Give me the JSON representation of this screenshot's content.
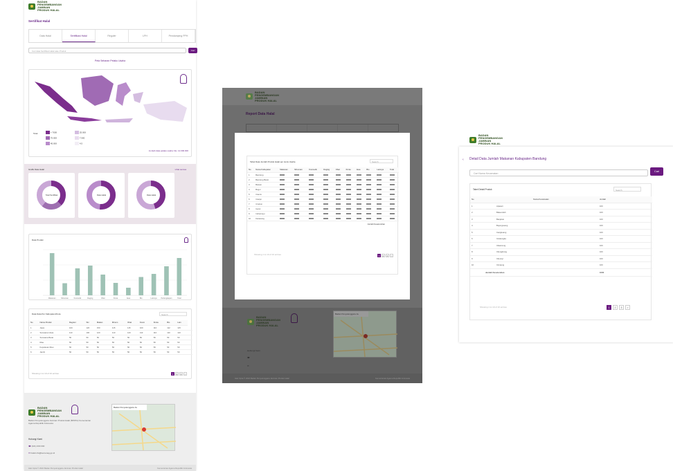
{
  "brand": {
    "name": "BADAN PENGEMBANGAN JAMINAN PRODUK HALAL",
    "logo_color": "#3f7d2a"
  },
  "accent": "#6b1a80",
  "panel1": {
    "title": "Sertifikat Halal",
    "tabs": [
      "Data Halal",
      "Sertifikasi Halal",
      "Reguler",
      "LPH",
      "Pendamping PPH"
    ],
    "search_placeholder": "Cari data Sertifikat Halal atau Produk",
    "search_button": "Cari",
    "map_title": "Peta Sebaran Pelaku Usaha",
    "legend_title": "Total",
    "legend_items": [
      "> 7000",
      "75.000",
      "45.000",
      "25.000",
      "7.500",
      "4.5"
    ],
    "map_note": "Jumlah data pelaku usaha: Rp. 12.000.000",
    "donut_section": {
      "title": "Grafik Data Halal",
      "link": "Lihat semua"
    },
    "donut_labels": [
      "Total Sertifikat",
      "Data Halal",
      "Data Halal"
    ],
    "bar_chart_title": "Data Produk",
    "table": {
      "title": "Data Data Per Kabupaten/Kota",
      "search": "Search",
      "headers": [
        "No",
        "Nama Produk",
        "Reguler",
        "SH",
        "Makan",
        "Minum",
        "Obat",
        "Kosm",
        "Kimia",
        "Bio",
        "Lain",
        "Jumlah"
      ],
      "rows": [
        [
          "1",
          "Jawa",
          "100",
          "120",
          "150",
          "115",
          "115",
          "100",
          "110",
          "112",
          "115"
        ],
        [
          "2",
          "Sumatera Utara",
          "110",
          "100",
          "120",
          "110",
          "120",
          "110",
          "110",
          "110",
          "110"
        ],
        [
          "3",
          "Sumatera Barat",
          "50",
          "50",
          "50",
          "50",
          "50",
          "50",
          "50",
          "50",
          "50"
        ],
        [
          "4",
          "Riau",
          "50",
          "50",
          "50",
          "50",
          "50",
          "50",
          "50",
          "50",
          "50"
        ],
        [
          "5",
          "Kepulauan Riau",
          "50",
          "50",
          "50",
          "50",
          "50",
          "50",
          "50",
          "50",
          "50"
        ],
        [
          "6",
          "Jambi",
          "50",
          "50",
          "50",
          "50",
          "50",
          "50",
          "50",
          "50",
          "50"
        ]
      ],
      "footer": "Showing 1 to 10 of 10 entries"
    },
    "footer": {
      "desc": "Badan Penyelenggara Jaminan Produk Halal (BPJPH) Kementerian Agama Republik Indonesia",
      "contact_title": "Hubungi Kami",
      "phone": "(021) 000 000",
      "email": "halal.info@kemenag.go.id",
      "map_title": "Badan Penyelenggara Ja",
      "copyright": "Hak Cipta © 2022 Badan Penyelenggara Jaminan Produk Halal",
      "right": "Kementerian Agama Republik Indonesia"
    }
  },
  "panel2": {
    "title": "Report Data Halal",
    "modal_title": "Tabel Data Jumlah Produk Halal per Jenis Usaha",
    "search": "Search",
    "headers": [
      "No",
      "Nama Kabupaten",
      "Makanan",
      "Minuman",
      "Kosmetik",
      "Daging",
      "Obat",
      "Kimia",
      "Jasa",
      "Bio",
      "Lainnya",
      "Total",
      "Jumlah"
    ],
    "rows": [
      [
        "1",
        "Bandung"
      ],
      [
        "2",
        "Bandung Barat"
      ],
      [
        "3",
        "Bekasi"
      ],
      [
        "4",
        "Bogor"
      ],
      [
        "5",
        "Ciamis"
      ],
      [
        "6",
        "Cianjur"
      ],
      [
        "7",
        "Cirebon"
      ],
      [
        "8",
        "Garut"
      ],
      [
        "9",
        "Indramayu"
      ],
      [
        "10",
        "Karawang"
      ]
    ],
    "total_label": "Jumlah Keseluruhan",
    "footer_note": "Showing 1 to 10 of 10 entries",
    "map_title": "Badan Penyelenggara Ja",
    "contact_title": "Hubungi Kami",
    "copyright": "Hak Cipta © 2022 Badan Penyelenggara Jaminan Produk Halal",
    "right": "Kementerian Agama Republik Indonesia"
  },
  "panel3": {
    "title": "Detail Data Jumlah Makanan Kabupaten Bandung",
    "search_placeholder": "Cari Nama Kecamatan",
    "search_button": "Cari",
    "card_title": "Tabel Detail Produk",
    "card_search": "Search",
    "headers": [
      "No",
      "Nama Kecamatan",
      "Jumlah"
    ],
    "rows": [
      [
        "1",
        "Arjasari",
        "100"
      ],
      [
        "2",
        "Baleendah",
        "100"
      ],
      [
        "3",
        "Banjaran",
        "100"
      ],
      [
        "4",
        "Bojongsoang",
        "100"
      ],
      [
        "5",
        "Cangkuang",
        "100"
      ],
      [
        "6",
        "Cicalengka",
        "100"
      ],
      [
        "7",
        "Cikancung",
        "100"
      ],
      [
        "8",
        "Cilengkrang",
        "100"
      ],
      [
        "9",
        "Cileunyi",
        "100"
      ],
      [
        "10",
        "Cimaung",
        "100"
      ]
    ],
    "total_label": "Jumlah Keseluruhan",
    "total_value": "1000",
    "footer_note": "Showing 1 to 10 of 10 entries",
    "pages": [
      "1",
      "2",
      "3",
      ">"
    ]
  },
  "chart_data": {
    "type": "bar",
    "categories": [
      "Makanan",
      "Minuman",
      "Kosmetik",
      "Daging",
      "Obat",
      "Kimia",
      "Jasa",
      "Bio",
      "Lainnya",
      "Perlengkapan",
      "Total"
    ],
    "values": [
      610,
      175,
      390,
      430,
      300,
      180,
      110,
      265,
      310,
      420,
      540
    ],
    "ylim": [
      0,
      700
    ]
  }
}
